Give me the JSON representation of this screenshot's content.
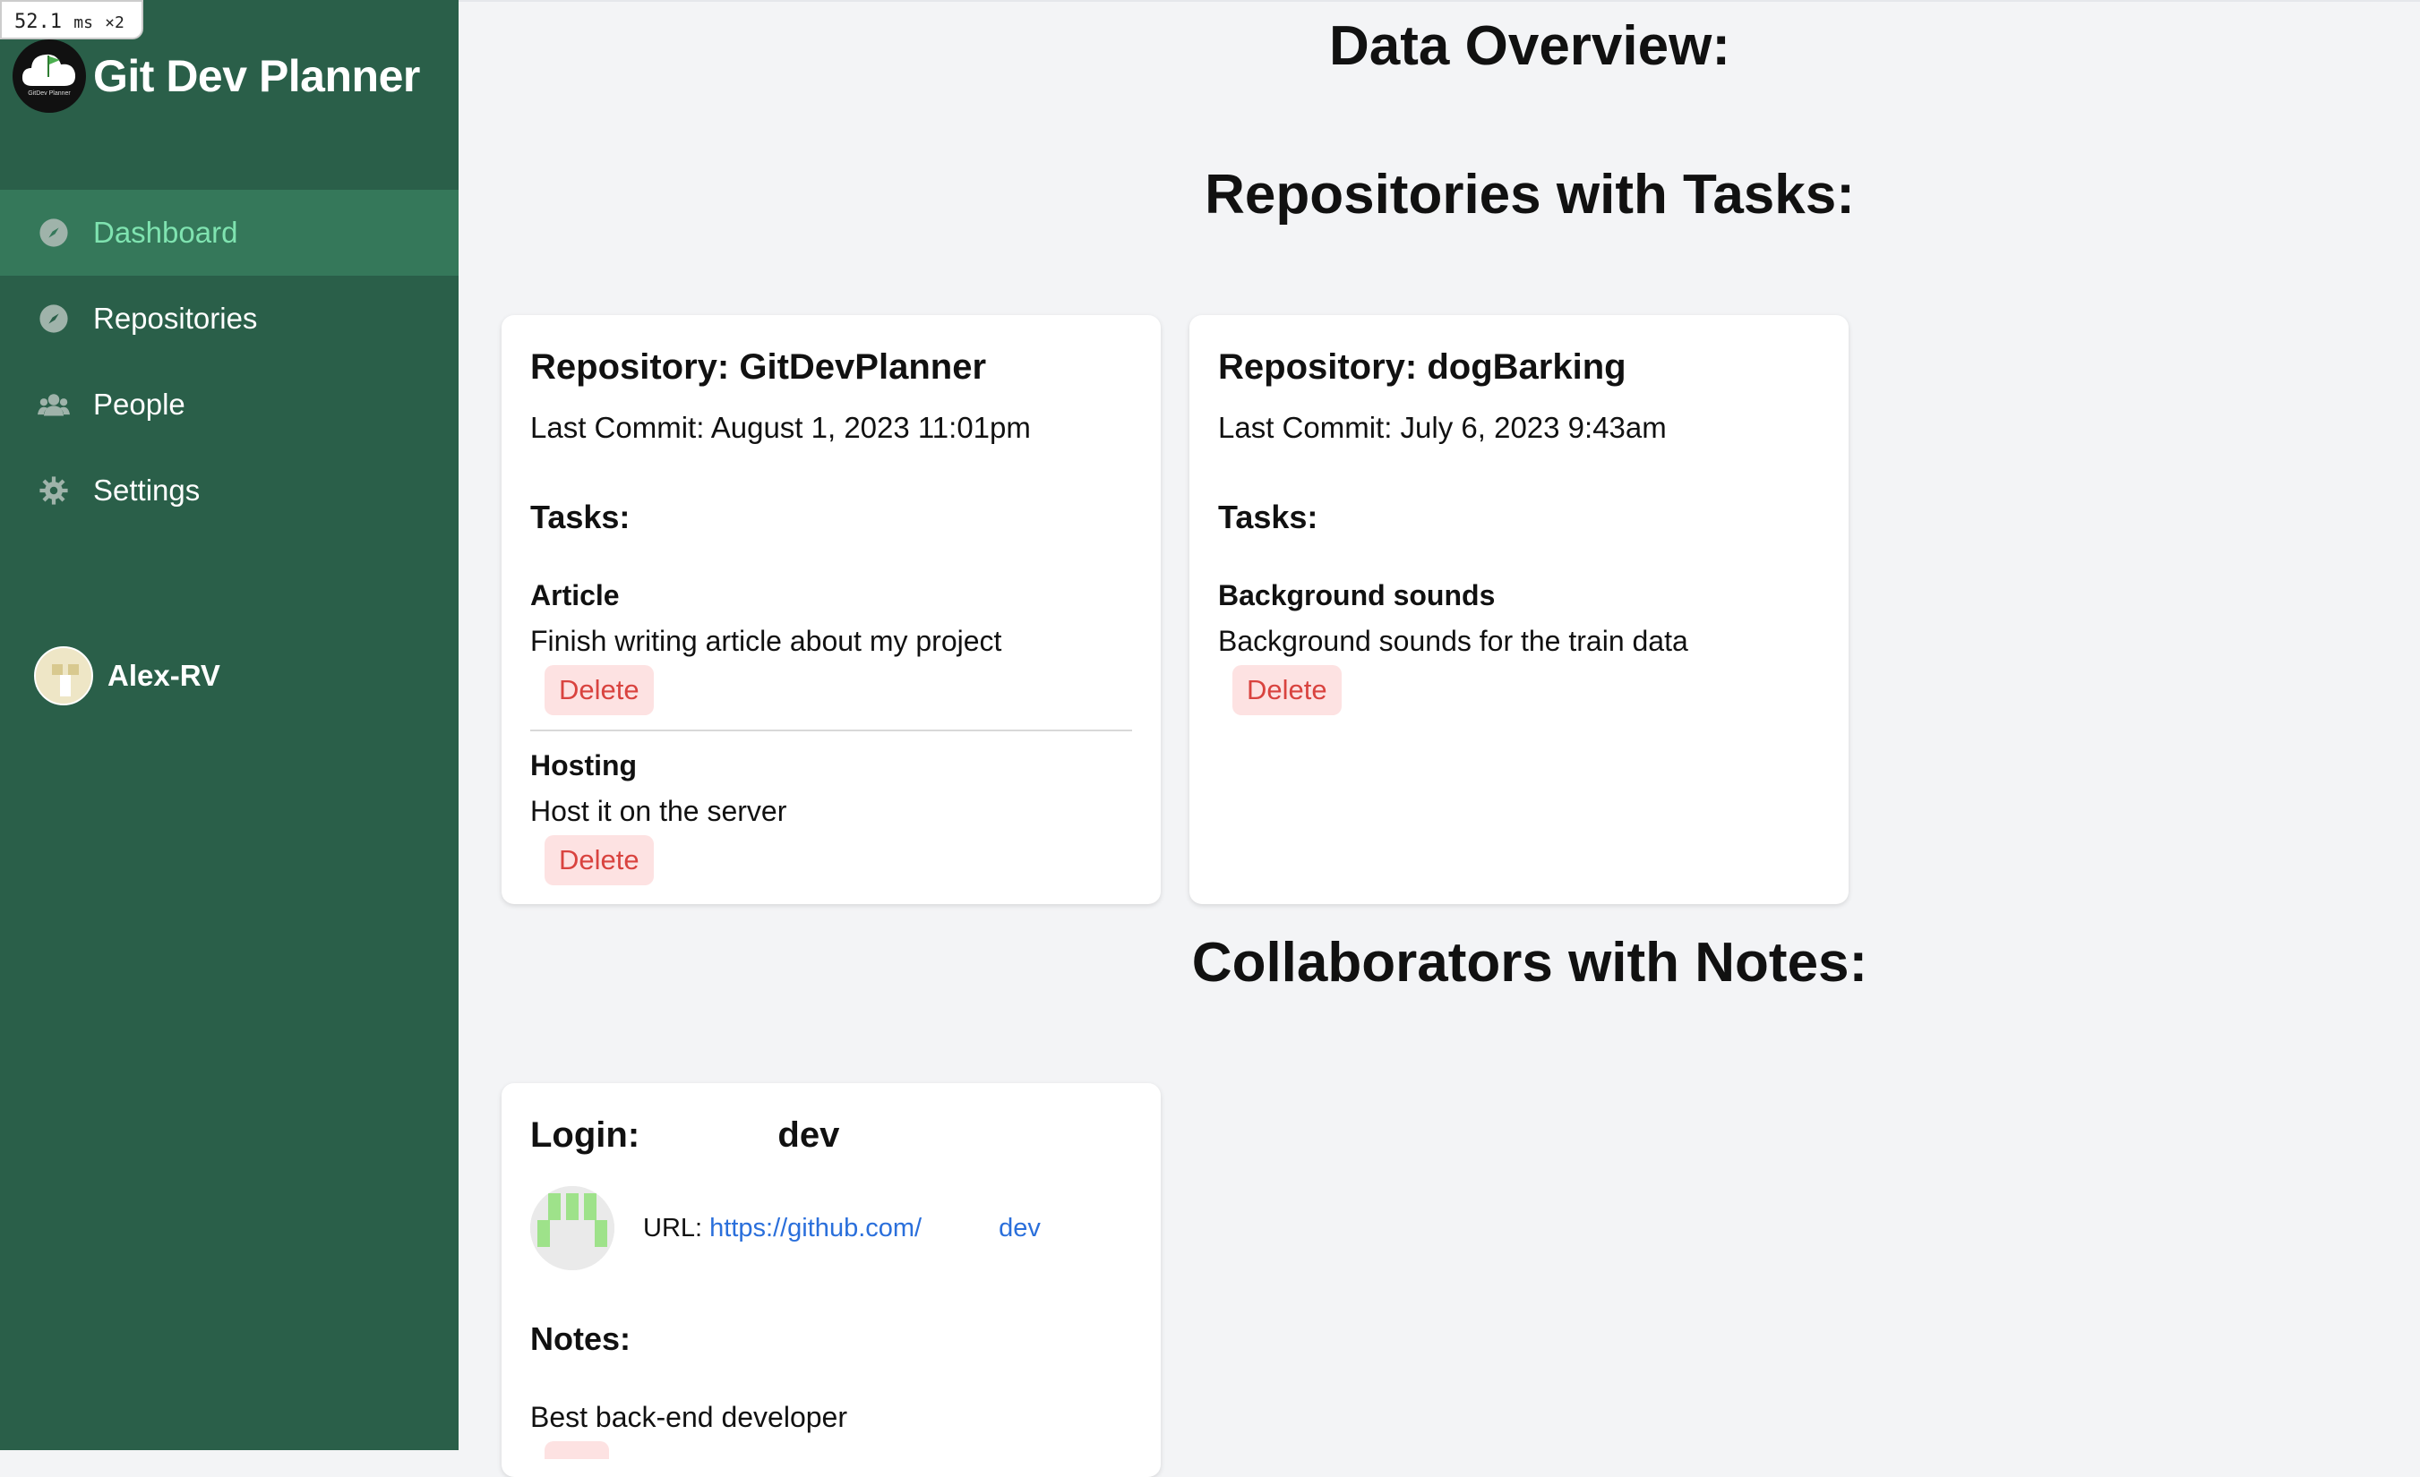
{
  "perf_badge": {
    "time": "52.1",
    "unit": "ms",
    "multiplier": "×2"
  },
  "sidebar": {
    "app_title": "Git Dev Planner",
    "logo_caption": "GitDev Planner",
    "nav": [
      {
        "label": "Dashboard",
        "icon": "compass-icon",
        "active": true
      },
      {
        "label": "Repositories",
        "icon": "compass-icon",
        "active": false
      },
      {
        "label": "People",
        "icon": "people-icon",
        "active": false
      },
      {
        "label": "Settings",
        "icon": "gear-icon",
        "active": false
      }
    ],
    "user": {
      "name": "Alex-RV"
    }
  },
  "main": {
    "overview_title": "Data Overview:",
    "repos_title": "Repositories with Tasks:",
    "collab_title": "Collaborators with Notes:",
    "repositories": [
      {
        "title": "Repository: GitDevPlanner",
        "last_commit": "Last Commit: August 1, 2023 11:01pm",
        "tasks_label": "Tasks:",
        "tasks": [
          {
            "title": "Article",
            "description": "Finish writing article about my project",
            "delete_label": "Delete"
          },
          {
            "title": "Hosting",
            "description": "Host it on the server",
            "delete_label": "Delete"
          }
        ]
      },
      {
        "title": "Repository: dogBarking",
        "last_commit": "Last Commit: July 6, 2023 9:43am",
        "tasks_label": "Tasks:",
        "tasks": [
          {
            "title": "Background sounds",
            "description": "Background sounds for the train data",
            "delete_label": "Delete"
          }
        ]
      }
    ],
    "collaborators": [
      {
        "login_label": "Login:",
        "login_suffix": "dev",
        "url_label": "URL:",
        "url_prefix": "https://github.com/",
        "url_suffix": "dev",
        "notes_label": "Notes:",
        "note": "Best back-end developer"
      }
    ]
  },
  "colors": {
    "sidebar_bg": "#2a5f49",
    "sidebar_active_bg": "#35785a",
    "sidebar_active_text": "#7fe3b0",
    "page_bg": "#f3f4f6",
    "delete_bg": "#fde2e2",
    "delete_text": "#d9433f",
    "link": "#2a6fdb"
  }
}
